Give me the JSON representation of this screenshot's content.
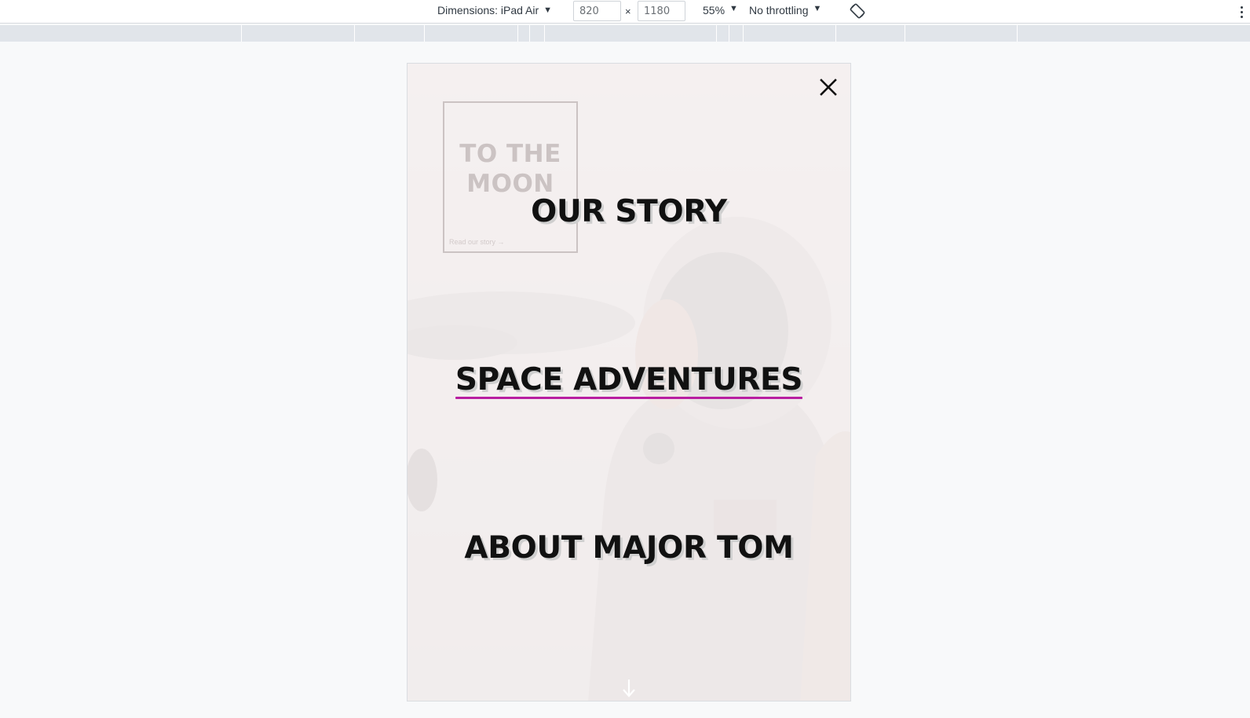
{
  "toolbar": {
    "device_label": "Dimensions: iPad Air",
    "width_value": "820",
    "height_value": "1180",
    "times_symbol": "×",
    "zoom_label": "55%",
    "throttle_label": "No throttling",
    "icons": [
      "caret-down-icon",
      "rotate-icon",
      "more-options-icon"
    ]
  },
  "page": {
    "hero": {
      "title": "TO THE MOON",
      "link": "Read our story →"
    },
    "nav": {
      "items": [
        {
          "label": "OUR STORY",
          "active": false
        },
        {
          "label": "SPACE ADVENTURES",
          "active": true
        },
        {
          "label": "ABOUT MAJOR TOM",
          "active": false
        }
      ],
      "accent_color": "#b81ea1"
    },
    "icons": [
      "close-icon",
      "arrow-down-icon"
    ]
  }
}
